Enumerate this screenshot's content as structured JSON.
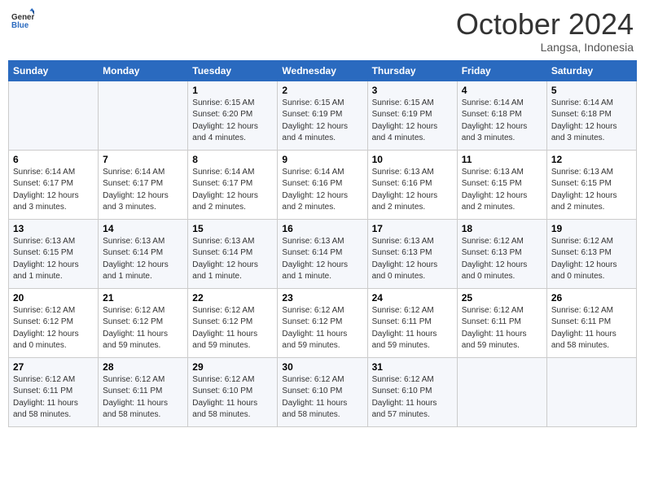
{
  "header": {
    "logo_line1": "General",
    "logo_line2": "Blue",
    "month_title": "October 2024",
    "location": "Langsa, Indonesia"
  },
  "weekdays": [
    "Sunday",
    "Monday",
    "Tuesday",
    "Wednesday",
    "Thursday",
    "Friday",
    "Saturday"
  ],
  "weeks": [
    [
      {
        "day": "",
        "info": ""
      },
      {
        "day": "",
        "info": ""
      },
      {
        "day": "1",
        "info": "Sunrise: 6:15 AM\nSunset: 6:20 PM\nDaylight: 12 hours\nand 4 minutes."
      },
      {
        "day": "2",
        "info": "Sunrise: 6:15 AM\nSunset: 6:19 PM\nDaylight: 12 hours\nand 4 minutes."
      },
      {
        "day": "3",
        "info": "Sunrise: 6:15 AM\nSunset: 6:19 PM\nDaylight: 12 hours\nand 4 minutes."
      },
      {
        "day": "4",
        "info": "Sunrise: 6:14 AM\nSunset: 6:18 PM\nDaylight: 12 hours\nand 3 minutes."
      },
      {
        "day": "5",
        "info": "Sunrise: 6:14 AM\nSunset: 6:18 PM\nDaylight: 12 hours\nand 3 minutes."
      }
    ],
    [
      {
        "day": "6",
        "info": "Sunrise: 6:14 AM\nSunset: 6:17 PM\nDaylight: 12 hours\nand 3 minutes."
      },
      {
        "day": "7",
        "info": "Sunrise: 6:14 AM\nSunset: 6:17 PM\nDaylight: 12 hours\nand 3 minutes."
      },
      {
        "day": "8",
        "info": "Sunrise: 6:14 AM\nSunset: 6:17 PM\nDaylight: 12 hours\nand 2 minutes."
      },
      {
        "day": "9",
        "info": "Sunrise: 6:14 AM\nSunset: 6:16 PM\nDaylight: 12 hours\nand 2 minutes."
      },
      {
        "day": "10",
        "info": "Sunrise: 6:13 AM\nSunset: 6:16 PM\nDaylight: 12 hours\nand 2 minutes."
      },
      {
        "day": "11",
        "info": "Sunrise: 6:13 AM\nSunset: 6:15 PM\nDaylight: 12 hours\nand 2 minutes."
      },
      {
        "day": "12",
        "info": "Sunrise: 6:13 AM\nSunset: 6:15 PM\nDaylight: 12 hours\nand 2 minutes."
      }
    ],
    [
      {
        "day": "13",
        "info": "Sunrise: 6:13 AM\nSunset: 6:15 PM\nDaylight: 12 hours\nand 1 minute."
      },
      {
        "day": "14",
        "info": "Sunrise: 6:13 AM\nSunset: 6:14 PM\nDaylight: 12 hours\nand 1 minute."
      },
      {
        "day": "15",
        "info": "Sunrise: 6:13 AM\nSunset: 6:14 PM\nDaylight: 12 hours\nand 1 minute."
      },
      {
        "day": "16",
        "info": "Sunrise: 6:13 AM\nSunset: 6:14 PM\nDaylight: 12 hours\nand 1 minute."
      },
      {
        "day": "17",
        "info": "Sunrise: 6:13 AM\nSunset: 6:13 PM\nDaylight: 12 hours\nand 0 minutes."
      },
      {
        "day": "18",
        "info": "Sunrise: 6:12 AM\nSunset: 6:13 PM\nDaylight: 12 hours\nand 0 minutes."
      },
      {
        "day": "19",
        "info": "Sunrise: 6:12 AM\nSunset: 6:13 PM\nDaylight: 12 hours\nand 0 minutes."
      }
    ],
    [
      {
        "day": "20",
        "info": "Sunrise: 6:12 AM\nSunset: 6:12 PM\nDaylight: 12 hours\nand 0 minutes."
      },
      {
        "day": "21",
        "info": "Sunrise: 6:12 AM\nSunset: 6:12 PM\nDaylight: 11 hours\nand 59 minutes."
      },
      {
        "day": "22",
        "info": "Sunrise: 6:12 AM\nSunset: 6:12 PM\nDaylight: 11 hours\nand 59 minutes."
      },
      {
        "day": "23",
        "info": "Sunrise: 6:12 AM\nSunset: 6:12 PM\nDaylight: 11 hours\nand 59 minutes."
      },
      {
        "day": "24",
        "info": "Sunrise: 6:12 AM\nSunset: 6:11 PM\nDaylight: 11 hours\nand 59 minutes."
      },
      {
        "day": "25",
        "info": "Sunrise: 6:12 AM\nSunset: 6:11 PM\nDaylight: 11 hours\nand 59 minutes."
      },
      {
        "day": "26",
        "info": "Sunrise: 6:12 AM\nSunset: 6:11 PM\nDaylight: 11 hours\nand 58 minutes."
      }
    ],
    [
      {
        "day": "27",
        "info": "Sunrise: 6:12 AM\nSunset: 6:11 PM\nDaylight: 11 hours\nand 58 minutes."
      },
      {
        "day": "28",
        "info": "Sunrise: 6:12 AM\nSunset: 6:11 PM\nDaylight: 11 hours\nand 58 minutes."
      },
      {
        "day": "29",
        "info": "Sunrise: 6:12 AM\nSunset: 6:10 PM\nDaylight: 11 hours\nand 58 minutes."
      },
      {
        "day": "30",
        "info": "Sunrise: 6:12 AM\nSunset: 6:10 PM\nDaylight: 11 hours\nand 58 minutes."
      },
      {
        "day": "31",
        "info": "Sunrise: 6:12 AM\nSunset: 6:10 PM\nDaylight: 11 hours\nand 57 minutes."
      },
      {
        "day": "",
        "info": ""
      },
      {
        "day": "",
        "info": ""
      }
    ]
  ]
}
